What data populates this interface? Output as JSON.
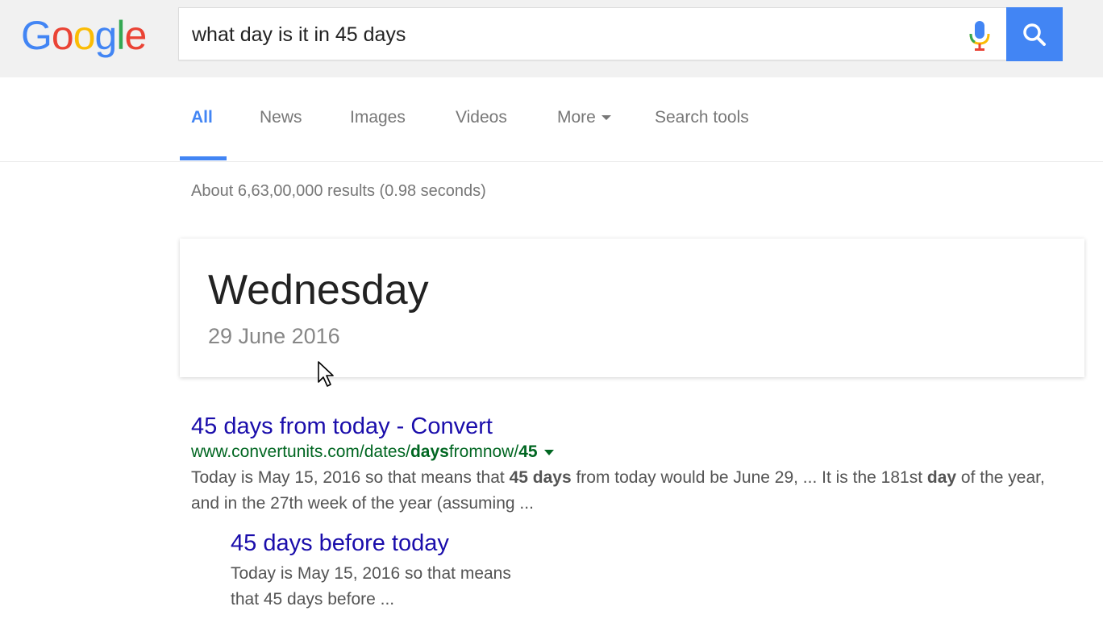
{
  "brand": {
    "logo_letters": [
      "G",
      "o",
      "o",
      "g",
      "l",
      "e"
    ],
    "logo_colors": [
      "#4285f4",
      "#ea4335",
      "#fbbc05",
      "#4285f4",
      "#34a853",
      "#ea4335"
    ]
  },
  "search": {
    "query": "what day is it in 45 days",
    "mic_icon": "mic-icon",
    "button_icon": "search-icon"
  },
  "tabs": [
    {
      "label": "All",
      "active": true
    },
    {
      "label": "News"
    },
    {
      "label": "Images"
    },
    {
      "label": "Videos"
    },
    {
      "label": "More"
    },
    {
      "label": "Search tools"
    }
  ],
  "stats": "About 6,63,00,000 results (0.98 seconds)",
  "answer_card": {
    "day": "Wednesday",
    "date": "29 June 2016"
  },
  "result": {
    "title": "45 days from today - Convert",
    "url_prefix": "www.convertunits.com/dates/",
    "url_bold_1": "days",
    "url_mid": "fromnow/",
    "url_bold_2": "45",
    "snippet_1": "Today is May 15, 2016 so that means that ",
    "snippet_bold_1": "45 days",
    "snippet_2": " from today would be June 29, ... It is the 181st ",
    "snippet_bold_2": "day",
    "snippet_3": " of the year, and in the 27th week of the year (assuming ..."
  },
  "sitelink": {
    "title": "45 days before today",
    "snippet_line_1": "Today is May 15, 2016 so that means",
    "snippet_line_2": "that 45 days before ..."
  },
  "colors": {
    "accent": "#4285f4",
    "link": "#1a0dab",
    "url": "#006621",
    "snippet": "#545454"
  }
}
